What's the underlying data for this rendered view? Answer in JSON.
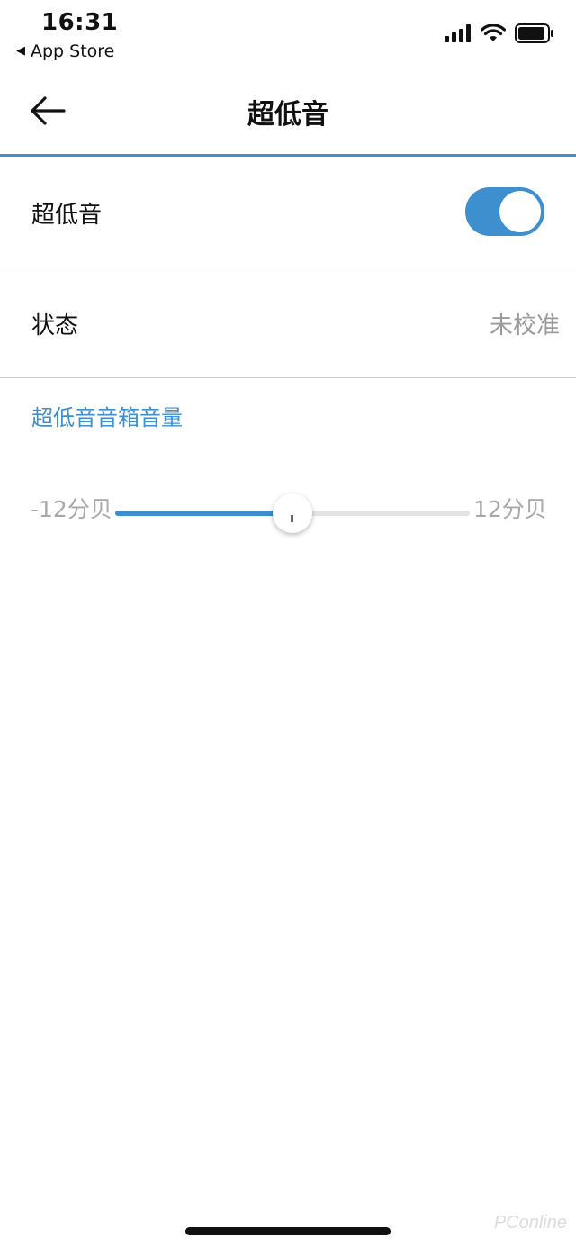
{
  "status_bar": {
    "time": "16:31",
    "back_app": "App Store",
    "icons": [
      "signal-icon",
      "wifi-icon",
      "battery-icon"
    ]
  },
  "nav": {
    "title": "超低音",
    "back_icon": "arrow-left-icon"
  },
  "settings": {
    "subwoofer_label": "超低音",
    "subwoofer_enabled": true,
    "status_label": "状态",
    "status_value": "未校准"
  },
  "volume": {
    "section_title": "超低音音箱音量",
    "min_label": "-12分贝",
    "max_label": "12分贝",
    "min": -12,
    "max": 12,
    "value": 0
  },
  "watermark": "PConline",
  "colors": {
    "accent": "#3d8fce",
    "divider": "#c9c9c9",
    "secondary_text": "#9a9a9a",
    "track": "#e3e3e3"
  }
}
